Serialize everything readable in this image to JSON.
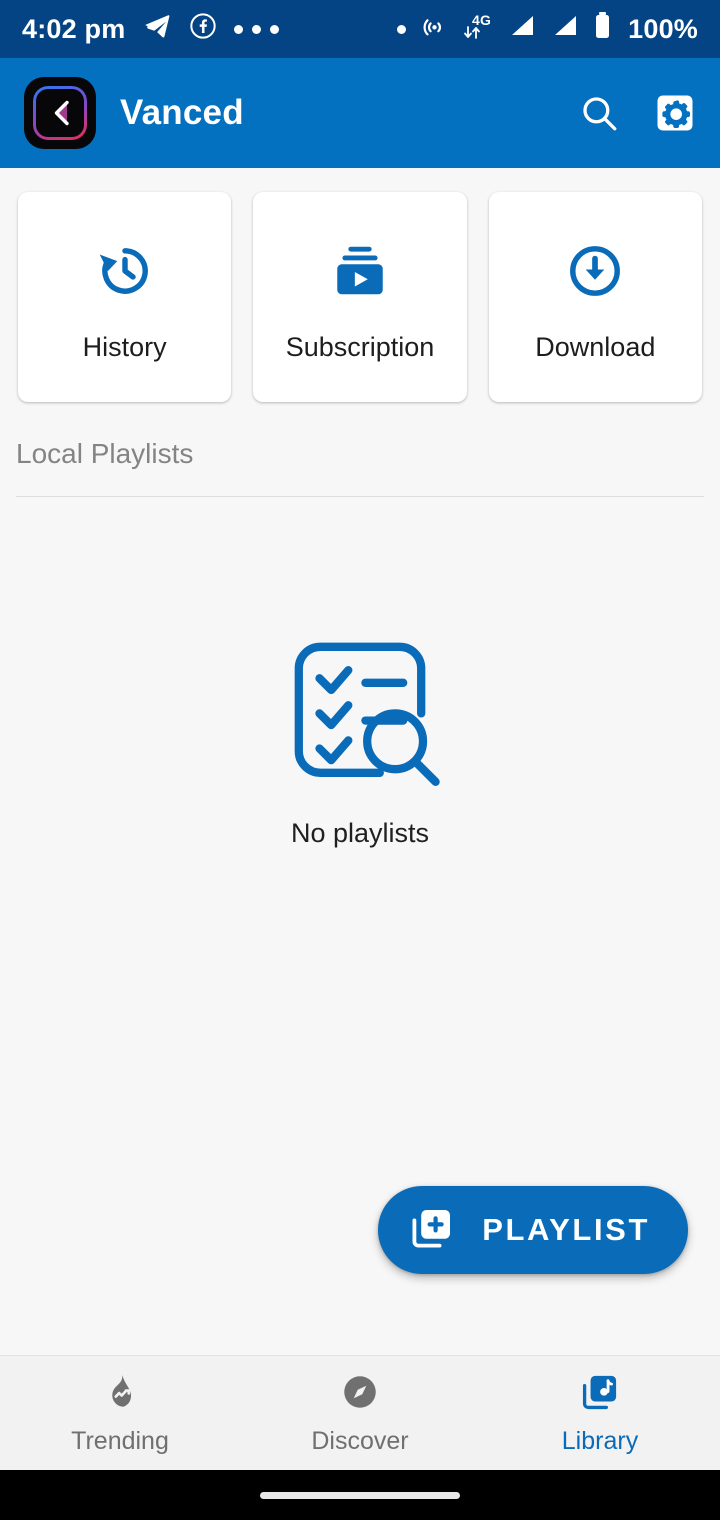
{
  "status_bar": {
    "time": "4:02 pm",
    "battery_percent": "100%",
    "network_type": "4G",
    "left_icons": [
      "telegram-icon",
      "facebook-icon",
      "more-notifications-icon"
    ],
    "right_icons": [
      "dot-indicator-icon",
      "hotspot-icon",
      "mobile-data-4g-icon",
      "signal-sim1-icon",
      "signal-sim2-icon",
      "battery-icon"
    ],
    "background_color": "#044484"
  },
  "app_bar": {
    "title": "Vanced",
    "logo_icon": "vanced-logo-icon",
    "search_icon": "search-icon",
    "settings_icon": "settings-gear-icon",
    "background_color": "#0470c0"
  },
  "quick_cards": [
    {
      "label": "History",
      "icon": "history-clock-icon"
    },
    {
      "label": "Subscription",
      "icon": "subscriptions-icon"
    },
    {
      "label": "Download",
      "icon": "download-circle-icon"
    }
  ],
  "section": {
    "title": "Local Playlists"
  },
  "empty_state": {
    "illustration_icon": "no-playlists-checklist-search-icon",
    "label": "No playlists"
  },
  "fab": {
    "label": "PLAYLIST",
    "icon": "playlist-add-icon",
    "color": "#0a6bb8"
  },
  "bottom_nav": {
    "active": "Library",
    "items": [
      {
        "label": "Trending",
        "icon": "trending-flame-icon",
        "active": false
      },
      {
        "label": "Discover",
        "icon": "compass-icon",
        "active": false
      },
      {
        "label": "Library",
        "icon": "music-library-icon",
        "active": true
      }
    ],
    "active_color": "#0a6bb8",
    "inactive_color": "#707070"
  },
  "theme": {
    "accent": "#0a6bb8",
    "page_background": "#f7f7f7",
    "card_background": "#ffffff"
  }
}
